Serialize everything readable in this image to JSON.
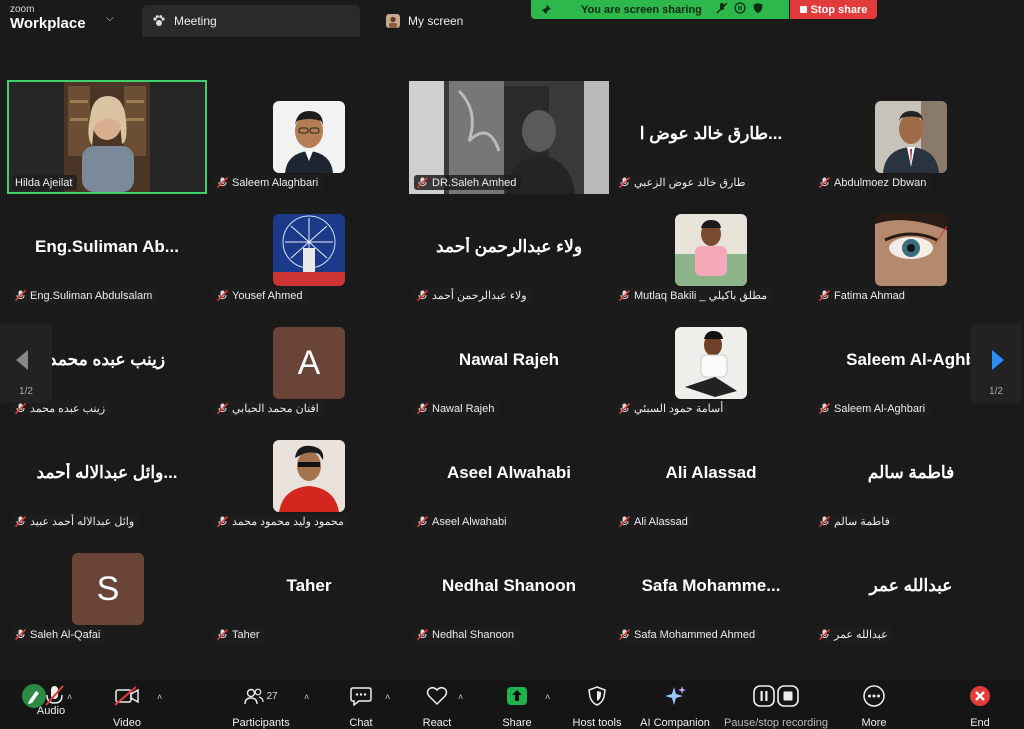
{
  "app": {
    "brand_top": "zoom",
    "brand_bottom": "Workplace"
  },
  "tabs": [
    {
      "label": "Meeting",
      "icon": "paw-icon"
    },
    {
      "label": "My screen",
      "icon": "avatar-icon"
    }
  ],
  "share_banner": {
    "text": "You are screen sharing",
    "stop_label": "Stop share",
    "color": "#2db84b",
    "stop_color": "#e23b3b"
  },
  "participants": [
    {
      "display": "",
      "tag": "Hilda Ajeilat",
      "muted": false,
      "type": "video"
    },
    {
      "display": "",
      "tag": "Saleem Alaghbari",
      "muted": true,
      "type": "photo"
    },
    {
      "display": "",
      "tag": "DR.Saleh Amhed",
      "muted": true,
      "type": "video"
    },
    {
      "display": "طارق خالد عوض ا...",
      "tag": "طارق خالد عوض الزعبي",
      "muted": true,
      "type": "name"
    },
    {
      "display": "",
      "tag": "Abdulmoez Dbwan",
      "muted": true,
      "type": "photo"
    },
    {
      "display": "Eng.Suliman  Ab...",
      "tag": "Eng.Suliman Abdulsalam",
      "muted": true,
      "type": "name"
    },
    {
      "display": "",
      "tag": "Yousef Ahmed",
      "muted": true,
      "type": "photo"
    },
    {
      "display": "ولاء عبدالرحمن أحمد",
      "tag": "ولاء عبدالرحمن أحمد",
      "muted": true,
      "type": "name"
    },
    {
      "display": "",
      "tag": "Mutlaq Bakili _ مطلق باكيلي",
      "muted": true,
      "type": "photo"
    },
    {
      "display": "",
      "tag": "Fatima Ahmad",
      "muted": true,
      "type": "photo"
    },
    {
      "display": "زينب عبده محمد",
      "tag": "زينب عبده محمد",
      "muted": true,
      "type": "name"
    },
    {
      "display": "A",
      "tag": "افنان محمد الحبابي",
      "muted": true,
      "type": "letter"
    },
    {
      "display": "Nawal Rajeh",
      "tag": "Nawal Rajeh",
      "muted": true,
      "type": "name"
    },
    {
      "display": "",
      "tag": "أسامة حمود السبئي",
      "muted": true,
      "type": "photo"
    },
    {
      "display": "Saleem  Al-Aghb",
      "tag": "Saleem Al-Aghbari",
      "muted": true,
      "type": "name"
    },
    {
      "display": "وائل عبدالاله أحمد...",
      "tag": "وائل عبدالاله أحمد عبيد",
      "muted": true,
      "type": "name"
    },
    {
      "display": "",
      "tag": "محمود وليد محمود محمد",
      "muted": true,
      "type": "photo"
    },
    {
      "display": "Aseel Alwahabi",
      "tag": "Aseel Alwahabi",
      "muted": true,
      "type": "name"
    },
    {
      "display": "Ali Alassad",
      "tag": "Ali Alassad",
      "muted": true,
      "type": "name"
    },
    {
      "display": "فاطمة سالم",
      "tag": "فاطمة سالم",
      "muted": true,
      "type": "name"
    },
    {
      "display": "S",
      "tag": "Saleh Al-Qafai",
      "muted": true,
      "type": "letter"
    },
    {
      "display": "Taher",
      "tag": "Taher",
      "muted": true,
      "type": "name"
    },
    {
      "display": "Nedhal Shanoon",
      "tag": "Nedhal Shanoon",
      "muted": true,
      "type": "name"
    },
    {
      "display": "Safa  Mohamme...",
      "tag": "Safa Mohammed  Ahmed",
      "muted": true,
      "type": "name"
    },
    {
      "display": "عبدالله عمر",
      "tag": "عبدالله عمر",
      "muted": true,
      "type": "name"
    }
  ],
  "pagination": {
    "left": "1/2",
    "right": "1/2"
  },
  "toolbar": {
    "audio": "Audio",
    "video": "Video",
    "participants": "Participants",
    "participants_count": "27",
    "chat": "Chat",
    "react": "React",
    "share": "Share",
    "host_tools": "Host tools",
    "ai_companion": "AI Companion",
    "recording": "Pause/stop recording",
    "more": "More",
    "end": "End"
  }
}
